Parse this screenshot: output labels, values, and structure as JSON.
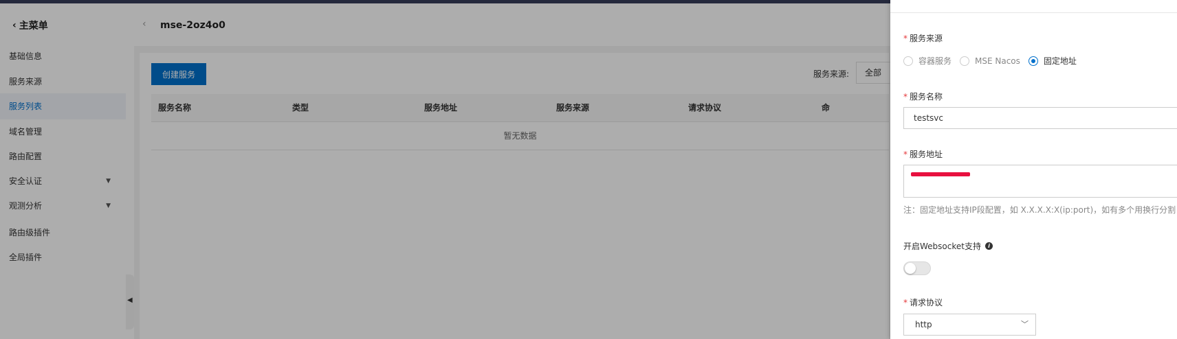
{
  "sidebar": {
    "back_label": "主菜单",
    "items": [
      {
        "label": "基础信息"
      },
      {
        "label": "服务来源"
      },
      {
        "label": "服务列表"
      },
      {
        "label": "域名管理"
      },
      {
        "label": "路由配置"
      },
      {
        "label": "安全认证"
      },
      {
        "label": "观测分析"
      },
      {
        "label": "路由级插件"
      },
      {
        "label": "全局插件"
      }
    ]
  },
  "main": {
    "title": "mse-2oz4o0",
    "create_button": "创建服务",
    "filter_label": "服务来源:",
    "filter_value": "全部",
    "columns": [
      "服务名称",
      "类型",
      "服务地址",
      "服务来源",
      "请求协议",
      "命"
    ],
    "empty_text": "暂无数据"
  },
  "drawer": {
    "source_label": "服务来源",
    "source_options": [
      "容器服务",
      "MSE Nacos",
      "固定地址"
    ],
    "source_selected": "固定地址",
    "name_label": "服务名称",
    "name_value": "testsvc",
    "address_label": "服务地址",
    "address_hint": "注：固定地址支持IP段配置，如 X.X.X.X:X(ip:port)，如有多个用换行分割",
    "websocket_label": "开启Websocket支持",
    "websocket_enabled": false,
    "protocol_label": "请求协议",
    "protocol_value": "http"
  },
  "colors": {
    "primary": "#0070cc",
    "required": "#e4393c",
    "redaction": "#e8103f"
  }
}
